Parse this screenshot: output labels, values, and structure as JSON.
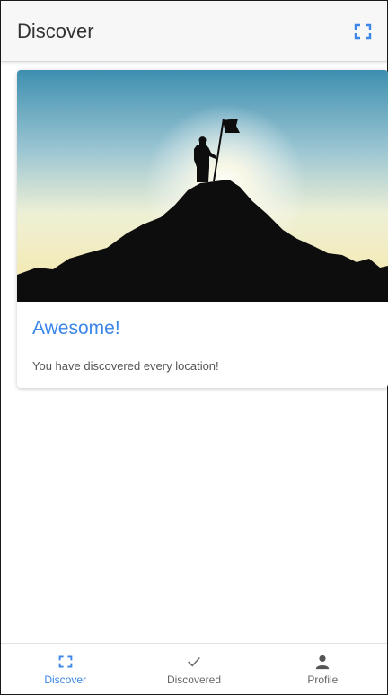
{
  "header": {
    "title": "Discover",
    "scan_icon": "scan-frame-icon"
  },
  "card": {
    "image": "mountain-summit-flag-photo",
    "title": "Awesome!",
    "text": "You have discovered every location!"
  },
  "bottom_nav": {
    "items": [
      {
        "label": "Discover",
        "icon": "scan-frame-icon",
        "active": true
      },
      {
        "label": "Discovered",
        "icon": "check-icon",
        "active": false
      },
      {
        "label": "Profile",
        "icon": "person-icon",
        "active": false
      }
    ]
  },
  "colors": {
    "accent": "#3b86e8",
    "header_bg": "#f7f7f7",
    "text_muted": "#555555"
  }
}
